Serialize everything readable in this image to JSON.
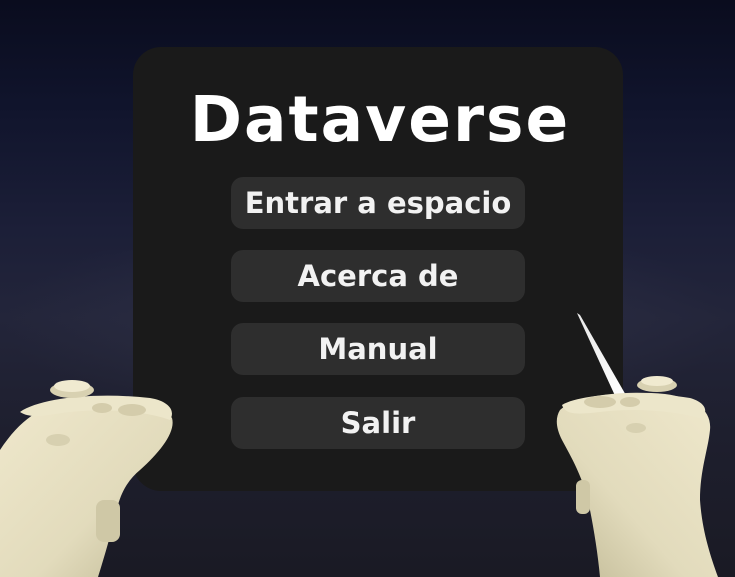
{
  "menu": {
    "title": "Dataverse",
    "buttons": [
      {
        "label": "Entrar a espacio"
      },
      {
        "label": "Acerca de"
      },
      {
        "label": "Manual"
      },
      {
        "label": "Salir"
      }
    ]
  },
  "colors": {
    "panel": "#1a1a1a",
    "button": "#2e2e2e",
    "text": "#ffffff",
    "controller": "#e6dfc0"
  },
  "icons": {
    "left_controller": "vr-controller-left-icon",
    "right_controller": "vr-controller-right-icon",
    "pointer": "laser-pointer-icon"
  }
}
